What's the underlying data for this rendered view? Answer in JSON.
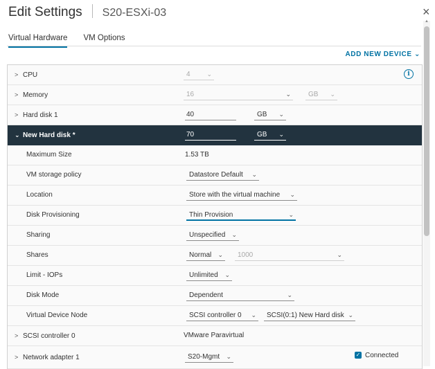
{
  "dialog": {
    "title": "Edit Settings",
    "vm_name": "S20-ESXi-03",
    "close_glyph": "×"
  },
  "tabs": [
    {
      "label": "Virtual Hardware",
      "active": true
    },
    {
      "label": "VM Options",
      "active": false
    }
  ],
  "add_device": "ADD NEW DEVICE ⌄",
  "rows": {
    "cpu": {
      "label": "CPU",
      "value": "4"
    },
    "memory": {
      "label": "Memory",
      "value": "16",
      "unit": "GB"
    },
    "hard_disk_1": {
      "label": "Hard disk 1",
      "value": "40",
      "unit": "GB"
    },
    "new_hard_disk": {
      "label": "New Hard disk *",
      "value": "70",
      "unit": "GB"
    },
    "maximum_size": {
      "label": "Maximum Size",
      "value": "1.53 TB"
    },
    "vm_storage_policy": {
      "label": "VM storage policy",
      "value": "Datastore Default"
    },
    "location": {
      "label": "Location",
      "value": "Store with the virtual machine"
    },
    "disk_provisioning": {
      "label": "Disk Provisioning",
      "value": "Thin Provision"
    },
    "sharing": {
      "label": "Sharing",
      "value": "Unspecified"
    },
    "shares": {
      "label": "Shares",
      "value": "Normal",
      "amount": "1000"
    },
    "limit_iops": {
      "label": "Limit - IOPs",
      "value": "Unlimited"
    },
    "disk_mode": {
      "label": "Disk Mode",
      "value": "Dependent"
    },
    "virtual_device_node": {
      "label": "Virtual Device Node",
      "controller": "SCSI controller 0",
      "node": "SCSI(0:1) New Hard disk"
    },
    "scsi_controller": {
      "label": "SCSI controller 0",
      "value": "VMware Paravirtual"
    },
    "network_adapter": {
      "label": "Network adapter 1",
      "value": "S20-Mgmt",
      "connected_label": "Connected",
      "connected": true
    }
  },
  "icons": {
    "expand": "chevron-right-icon",
    "collapse": "chevron-down-icon",
    "info": "info-icon",
    "close": "close-icon"
  },
  "colors": {
    "accent": "#0072a3",
    "selected_row": "#22333f"
  }
}
